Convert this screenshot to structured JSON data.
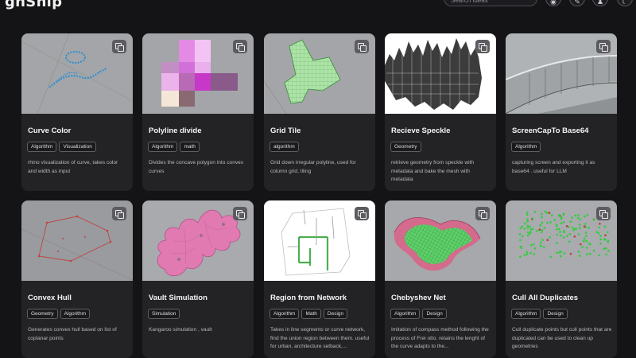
{
  "header": {
    "logo": "ghShip",
    "search_placeholder": "Search ideas",
    "buttons": [
      {
        "name": "github-icon",
        "glyph": "◉"
      },
      {
        "name": "pen-icon",
        "glyph": "✎"
      },
      {
        "name": "user-icon",
        "glyph": "♟"
      },
      {
        "name": "theme-icon",
        "glyph": "☾"
      }
    ]
  },
  "cards": [
    {
      "title": "Curve Color",
      "tags": [
        "Algorithm",
        "Visualization"
      ],
      "description": "rhino visualization of curve, takes color and width as input"
    },
    {
      "title": "Polyline divide",
      "tags": [
        "Algorithm",
        "math"
      ],
      "description": "Divides the concave polygon into convex curves"
    },
    {
      "title": "Grid Tile",
      "tags": [
        "algorithm"
      ],
      "description": "Grid down irregular polyline, used for column grid, tiling"
    },
    {
      "title": "Recieve Speckle",
      "tags": [
        "Geometry"
      ],
      "description": "retrieve geometry from speckle with metadata and bake the mesh with metadata"
    },
    {
      "title": "ScreenCapTo Base64",
      "tags": [
        "Algorithm"
      ],
      "description": "capturing screen and exporting it as base64 . useful for LLM"
    },
    {
      "title": "Convex Hull",
      "tags": [
        "Geometry",
        "Algorithm"
      ],
      "description": "Generates convex hull based on list of coplanar points"
    },
    {
      "title": "Vault Simulation",
      "tags": [
        "Simulation"
      ],
      "description": "Kangaroo simulation , vault"
    },
    {
      "title": "Region from Network",
      "tags": [
        "Algorithm",
        "Math",
        "Design"
      ],
      "description": "Takes in line segments or curve network, find the union region between them. useful for urban, architecture setback,..."
    },
    {
      "title": "Chebyshev Net",
      "tags": [
        "Algorithm",
        "Design"
      ],
      "description": "Imitation of compass method following the process of Frei otto. retains the lenght of the curve adapts to the..."
    },
    {
      "title": "Cull All Duplicates",
      "tags": [
        "Algorithm",
        "Design"
      ],
      "description": "Cull duplicate points but cull points that are duplicated can be used to clean up geometries"
    }
  ]
}
